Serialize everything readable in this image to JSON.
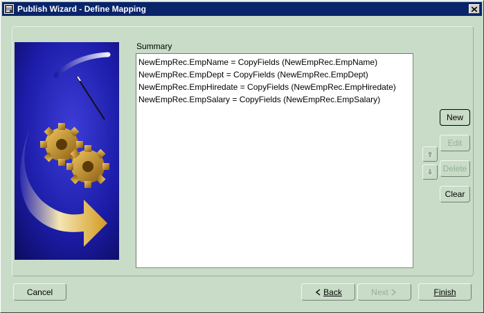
{
  "window": {
    "title": "Publish Wizard - Define Mapping"
  },
  "summary": {
    "label": "Summary",
    "rows": [
      "NewEmpRec.EmpName = CopyFields (NewEmpRec.EmpName)",
      "NewEmpRec.EmpDept = CopyFields (NewEmpRec.EmpDept)",
      "NewEmpRec.EmpHiredate = CopyFields (NewEmpRec.EmpHiredate)",
      "NewEmpRec.EmpSalary = CopyFields (NewEmpRec.EmpSalary)"
    ]
  },
  "side_buttons": {
    "new_label": "New",
    "edit_label": "Edit",
    "delete_label": "Delete",
    "clear_label": "Clear"
  },
  "footer": {
    "cancel_label": "Cancel",
    "back_label": "Back",
    "next_label": "Next",
    "finish_label": "Finish"
  },
  "icons": {
    "window": "app-icon",
    "close": "close-icon",
    "move_up": "arrow-up-icon",
    "move_down": "arrow-down-icon",
    "back": "chevron-left-icon",
    "next": "chevron-right-icon",
    "illustration": "gears-wizard-graphic"
  },
  "colors": {
    "titlebar": "#0a246a",
    "panel": "#c8dcc8",
    "graphic_blue": "#1a1aa0",
    "disabled_text": "#98ac98"
  }
}
